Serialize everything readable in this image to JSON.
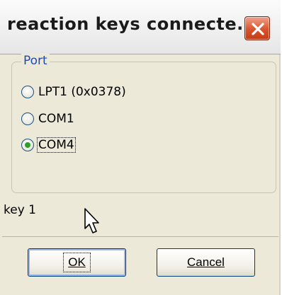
{
  "window": {
    "title": "reaction keys connecte...",
    "close_icon": "close-x-icon",
    "close_color": "#d9532c"
  },
  "port_group": {
    "legend": "Port",
    "legend_color": "#1c4bb8",
    "options": [
      {
        "label": "LPT1 (0x0378)",
        "selected": false
      },
      {
        "label": "COM1",
        "selected": false
      },
      {
        "label": "COM4",
        "selected": true
      }
    ]
  },
  "status": {
    "key_text": "key 1"
  },
  "buttons": {
    "ok_label": "OK",
    "cancel_label": "Cancel"
  },
  "cursor": {
    "icon": "mouse-pointer-icon"
  }
}
